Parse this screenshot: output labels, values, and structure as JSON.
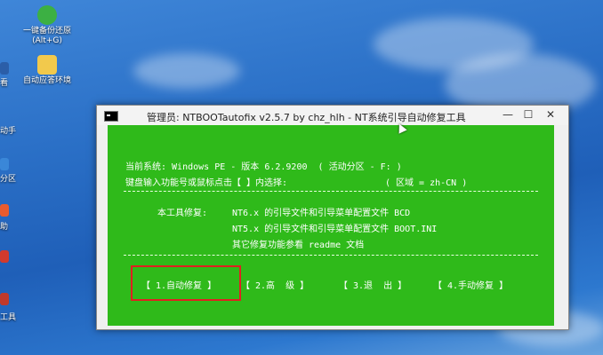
{
  "desktop": {
    "icons": [
      {
        "label": "一键备份还原\n(Alt+G)",
        "icon": "backup-restore-icon",
        "color": "#3cb043"
      },
      {
        "label": "自动应答环境",
        "icon": "folder-icon",
        "color": "#f2c94c"
      }
    ],
    "left_edge_labels": [
      "看",
      "动手",
      "分区",
      "助",
      "工具"
    ]
  },
  "window": {
    "title": "管理员: NTBOOTautofix v2.5.7 by chz_hlh - NT系统引导自动修复工具",
    "controls": {
      "minimize": "—",
      "maximize": "☐",
      "close": "✕"
    }
  },
  "console": {
    "background": "#2fba1a",
    "current_system": "当前系统: Windows PE - 版本 6.2.9200  ( 活动分区 - F: )",
    "input_prompt": "键盘输入功能号或鼠标点击【 】内选择:",
    "locale": "( 区域 = zh-CN )",
    "tool_repair_label": "本工具修复:",
    "repair_lines": [
      "NT6.x 的引导文件和引导菜单配置文件 BCD",
      "NT5.x 的引导文件和引导菜单配置文件 BOOT.INI",
      "其它修复功能参看 readme 文档"
    ],
    "menu": [
      "【 1.自动修复 】",
      "【 2.高  级 】",
      "【 3.退  出 】",
      "【 4.手动修复 】"
    ],
    "highlight_color": "#e02020"
  }
}
